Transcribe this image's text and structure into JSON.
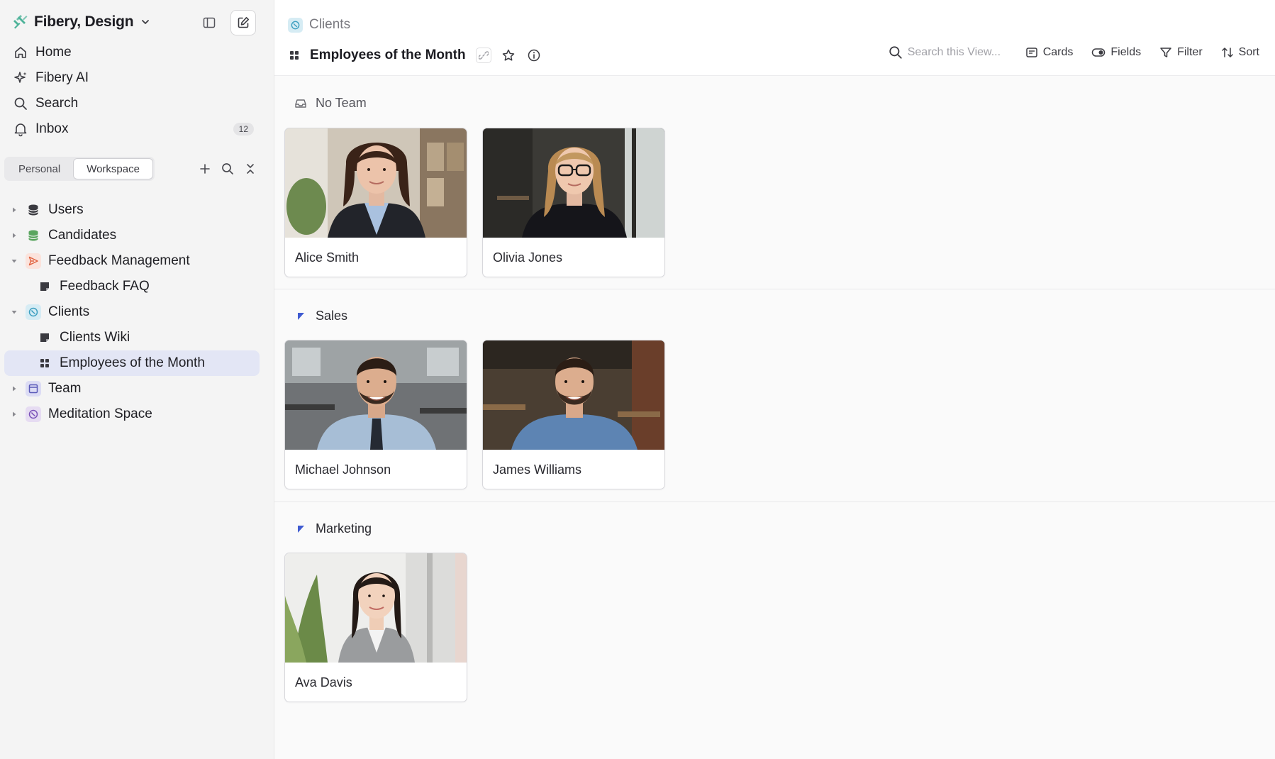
{
  "workspace": {
    "name": "Fibery, Design"
  },
  "nav": [
    {
      "label": "Home",
      "icon": "home-icon"
    },
    {
      "label": "Fibery AI",
      "icon": "sparkle-icon"
    },
    {
      "label": "Search",
      "icon": "search-icon"
    },
    {
      "label": "Inbox",
      "icon": "bell-icon",
      "badge": "12"
    }
  ],
  "tabs": {
    "personal": "Personal",
    "workspace": "Workspace",
    "active": "Workspace"
  },
  "tree": [
    {
      "label": "Users"
    },
    {
      "label": "Candidates"
    },
    {
      "label": "Feedback Management"
    },
    {
      "label": "Feedback FAQ"
    },
    {
      "label": "Clients"
    },
    {
      "label": "Clients Wiki"
    },
    {
      "label": "Employees of the Month"
    },
    {
      "label": "Team"
    },
    {
      "label": "Meditation Space"
    }
  ],
  "breadcrumb": "Clients",
  "view": {
    "title": "Employees of the Month",
    "search_placeholder": "Search this View...",
    "toolbar": {
      "cards": "Cards",
      "fields": "Fields",
      "filter": "Filter",
      "sort": "Sort"
    }
  },
  "groups": [
    {
      "title": "No Team",
      "cards": [
        {
          "name": "Alice Smith"
        },
        {
          "name": "Olivia Jones"
        }
      ]
    },
    {
      "title": "Sales",
      "cards": [
        {
          "name": "Michael Johnson"
        },
        {
          "name": "James Williams"
        }
      ]
    },
    {
      "title": "Marketing",
      "cards": [
        {
          "name": "Ava Davis"
        }
      ]
    }
  ],
  "colors": {
    "selected_row": "#e3e6f5",
    "accent_blue": "#3f5bd1",
    "sidebar_bg": "#f4f4f4"
  }
}
